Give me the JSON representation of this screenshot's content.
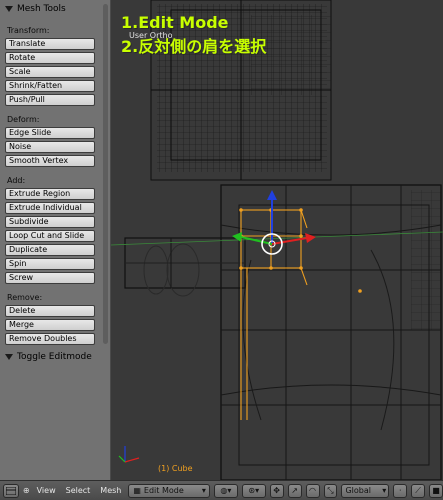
{
  "shelf": {
    "panel_title": "Mesh Tools",
    "sections": [
      {
        "label": "Transform:",
        "buttons": [
          "Translate",
          "Rotate",
          "Scale",
          "Shrink/Fatten",
          "Push/Pull"
        ]
      },
      {
        "label": "Deform:",
        "buttons": [
          "Edge Slide",
          "Noise",
          "Smooth Vertex"
        ]
      },
      {
        "label": "Add:",
        "buttons": [
          "Extrude Region",
          "Extrude Individual",
          "Subdivide",
          "Loop Cut and Slide",
          "Duplicate",
          "Spin",
          "Screw"
        ]
      },
      {
        "label": "Remove:",
        "buttons": [
          "Delete",
          "Merge",
          "Remove Doubles"
        ]
      }
    ],
    "toggle_panel": "Toggle Editmode"
  },
  "viewport": {
    "view_name": "User Ortho",
    "overlay_lines": [
      "1.Edit Mode",
      "2.反対側の肩を選択"
    ],
    "object_name": "(1) Cube",
    "colors": {
      "overlay_text": "#c8ff00",
      "selection": "#f0a020",
      "x_axis": "#e02020",
      "y_axis": "#20c020",
      "z_axis": "#2040e0"
    }
  },
  "header": {
    "menus": [
      "View",
      "Select",
      "Mesh"
    ],
    "mode": "Edit Mode",
    "orientation": "Global"
  }
}
